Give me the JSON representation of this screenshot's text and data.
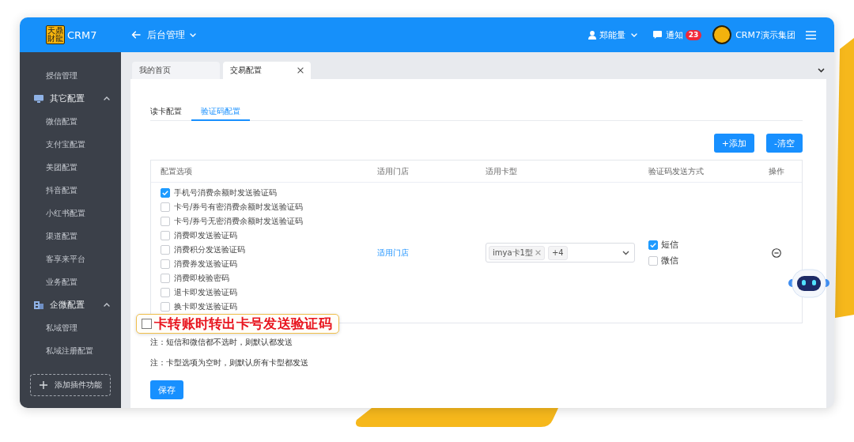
{
  "header": {
    "logo_text": "天鼎財龍",
    "app_name": "CRM7",
    "title": "后台管理",
    "user": "郑能量",
    "notice_label": "通知",
    "notice_count": "23",
    "org": "CRM7演示集团"
  },
  "sidebar": {
    "items": [
      {
        "kind": "item",
        "label": "授信管理"
      },
      {
        "kind": "group",
        "label": "其它配置",
        "expanded": true,
        "children": [
          {
            "label": "微信配置"
          },
          {
            "label": "支付宝配置"
          },
          {
            "label": "美团配置"
          },
          {
            "label": "抖音配置"
          },
          {
            "label": "小红书配置"
          },
          {
            "label": "渠道配置"
          },
          {
            "label": "客享来平台"
          },
          {
            "label": "业务配置"
          }
        ]
      },
      {
        "kind": "group",
        "label": "企微配置",
        "expanded": true,
        "children": [
          {
            "label": "私域管理"
          },
          {
            "label": "私域注册配置"
          }
        ]
      }
    ],
    "add_button": "添加插件功能"
  },
  "page_tabs": [
    {
      "label": "我的首页",
      "selected": false,
      "closable": false
    },
    {
      "label": "交易配置",
      "selected": true,
      "closable": true
    }
  ],
  "config_tabs": [
    {
      "label": "读卡配置",
      "selected": false
    },
    {
      "label": "验证码配置",
      "selected": true
    }
  ],
  "toolbar": [
    "+添加",
    "-清空"
  ],
  "table": {
    "columns": [
      "配置选项",
      "适用门店",
      "适用卡型",
      "验证码发送方式",
      "操作"
    ],
    "rows": [
      {
        "options": [
          {
            "label": "手机号消费余额时发送验证码",
            "checked": true
          },
          {
            "label": "卡号/券号有密消费余额时发送验证码",
            "checked": false
          },
          {
            "label": "卡号/券号无密消费余额时发送验证码",
            "checked": false
          },
          {
            "label": "消费即发送验证码",
            "checked": false
          },
          {
            "label": "消费积分发送验证码",
            "checked": false
          },
          {
            "label": "消费券发送验证码",
            "checked": false
          },
          {
            "label": "消费即校验密码",
            "checked": false
          },
          {
            "label": "退卡即发送验证码",
            "checked": false
          },
          {
            "label": "换卡即发送验证码",
            "checked": false
          }
        ],
        "store_link": "适用门店",
        "card_types": {
          "tags": [
            "imya卡1型"
          ],
          "more": "+4"
        },
        "send_methods": [
          {
            "label": "短信",
            "checked": true
          },
          {
            "label": "微信",
            "checked": false
          }
        ]
      }
    ]
  },
  "callout": {
    "label": "卡转账时转出卡号发送验证码",
    "checked": false
  },
  "notes": [
    "注：短信和微信都不选时，则默认都发送",
    "注：卡型选项为空时，则默认所有卡型都发送"
  ],
  "save_button": "保存"
}
